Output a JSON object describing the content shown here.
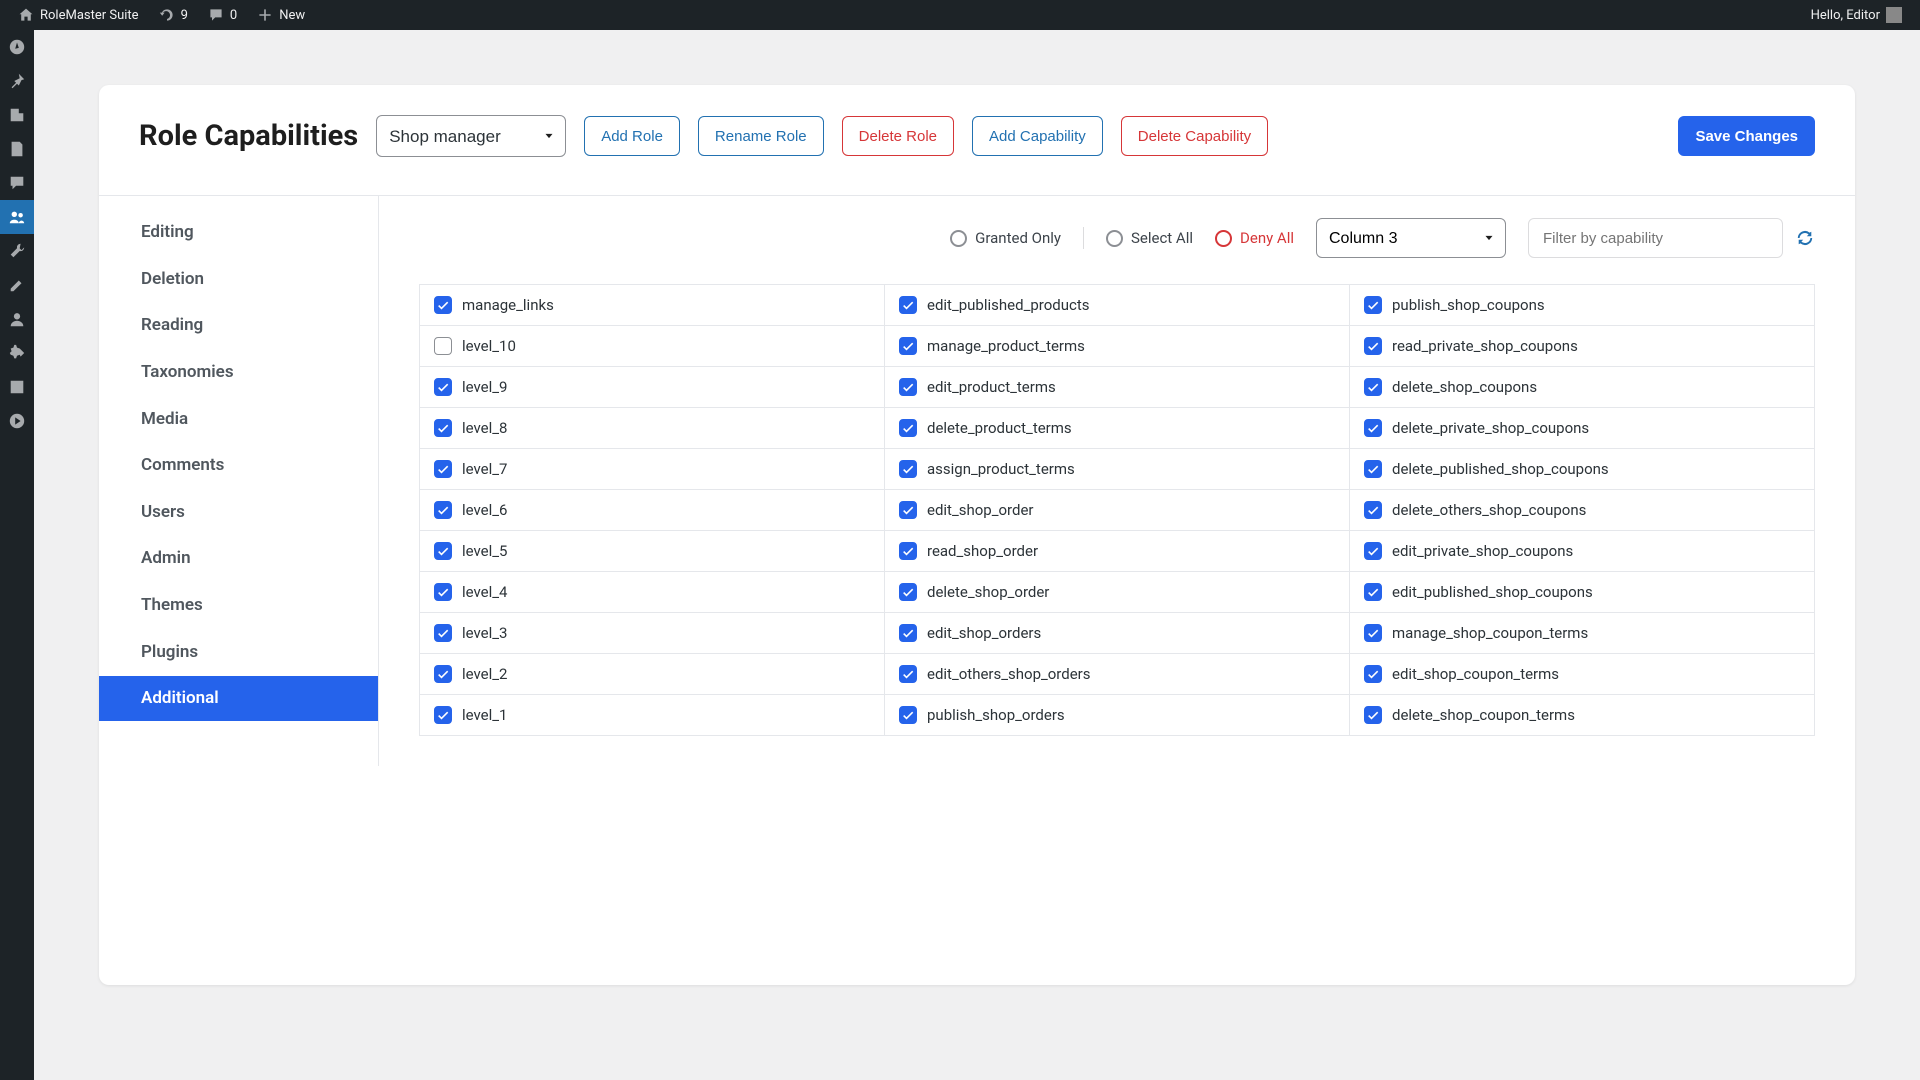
{
  "adminbar": {
    "site_name": "RoleMaster Suite",
    "updates": "9",
    "comments": "0",
    "new": "New",
    "hello": "Hello, Editor"
  },
  "sidebar_icons": [
    "dashboard",
    "pin",
    "media",
    "pages",
    "comments",
    "members",
    "tools",
    "appearance",
    "users",
    "settings",
    "collapse",
    "play"
  ],
  "active_sidebar_index": 5,
  "header": {
    "title": "Role Capabilities",
    "role_selected": "Shop manager",
    "add_role": "Add Role",
    "rename_role": "Rename Role",
    "delete_role": "Delete Role",
    "add_capability": "Add Capability",
    "delete_capability": "Delete Capability",
    "save": "Save Changes"
  },
  "cat_tabs": [
    "Editing",
    "Deletion",
    "Reading",
    "Taxonomies",
    "Media",
    "Comments",
    "Users",
    "Admin",
    "Themes",
    "Plugins",
    "Additional"
  ],
  "active_cat": "Additional",
  "toolbar": {
    "granted_only": "Granted Only",
    "select_all": "Select All",
    "deny_all": "Deny All",
    "column_selected": "Column 3",
    "filter_placeholder": "Filter by capability"
  },
  "caps": {
    "col1": [
      {
        "label": "manage_links",
        "checked": true
      },
      {
        "label": "level_10",
        "checked": false
      },
      {
        "label": "level_9",
        "checked": true
      },
      {
        "label": "level_8",
        "checked": true
      },
      {
        "label": "level_7",
        "checked": true
      },
      {
        "label": "level_6",
        "checked": true
      },
      {
        "label": "level_5",
        "checked": true
      },
      {
        "label": "level_4",
        "checked": true
      },
      {
        "label": "level_3",
        "checked": true
      },
      {
        "label": "level_2",
        "checked": true
      },
      {
        "label": "level_1",
        "checked": true
      }
    ],
    "col2": [
      {
        "label": "edit_published_products",
        "checked": true
      },
      {
        "label": "manage_product_terms",
        "checked": true
      },
      {
        "label": "edit_product_terms",
        "checked": true
      },
      {
        "label": "delete_product_terms",
        "checked": true
      },
      {
        "label": "assign_product_terms",
        "checked": true
      },
      {
        "label": "edit_shop_order",
        "checked": true
      },
      {
        "label": "read_shop_order",
        "checked": true
      },
      {
        "label": "delete_shop_order",
        "checked": true
      },
      {
        "label": "edit_shop_orders",
        "checked": true
      },
      {
        "label": "edit_others_shop_orders",
        "checked": true
      },
      {
        "label": "publish_shop_orders",
        "checked": true
      }
    ],
    "col3": [
      {
        "label": "publish_shop_coupons",
        "checked": true
      },
      {
        "label": "read_private_shop_coupons",
        "checked": true
      },
      {
        "label": "delete_shop_coupons",
        "checked": true
      },
      {
        "label": "delete_private_shop_coupons",
        "checked": true
      },
      {
        "label": "delete_published_shop_coupons",
        "checked": true
      },
      {
        "label": "delete_others_shop_coupons",
        "checked": true
      },
      {
        "label": "edit_private_shop_coupons",
        "checked": true
      },
      {
        "label": "edit_published_shop_coupons",
        "checked": true
      },
      {
        "label": "manage_shop_coupon_terms",
        "checked": true
      },
      {
        "label": "edit_shop_coupon_terms",
        "checked": true
      },
      {
        "label": "delete_shop_coupon_terms",
        "checked": true
      }
    ]
  }
}
